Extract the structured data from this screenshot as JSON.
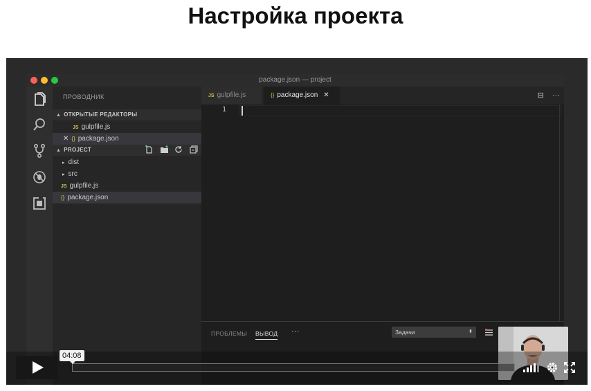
{
  "page": {
    "title": "Настройка проекта"
  },
  "window": {
    "title": "package.json — project"
  },
  "activity_bar": {
    "icons": [
      "files-icon",
      "search-icon",
      "source-control-icon",
      "debug-icon",
      "extensions-icon"
    ]
  },
  "sidebar": {
    "header": "ПРОВОДНИК",
    "open_editors": {
      "title": "ОТКРЫТЫЕ РЕДАКТОРЫ",
      "items": [
        {
          "badge": "JS",
          "label": "gulpfile.js"
        },
        {
          "close": "✕",
          "badge": "{}",
          "label": "package.json"
        }
      ]
    },
    "project": {
      "title": "PROJECT",
      "items": [
        {
          "badge": "▸",
          "label": "dist"
        },
        {
          "badge": "▸",
          "label": "src"
        },
        {
          "badge": "JS",
          "label": "gulpfile.js"
        },
        {
          "badge": "{}",
          "label": "package.json"
        }
      ]
    }
  },
  "tabs": [
    {
      "badge": "JS",
      "label": "gulpfile.js",
      "active": false
    },
    {
      "badge": "{}",
      "label": "package.json",
      "active": true,
      "close": "✕"
    }
  ],
  "editor": {
    "line_numbers": [
      "1"
    ],
    "actions": [
      "⊟",
      "···"
    ]
  },
  "panel": {
    "tabs": [
      "ПРОБЛЕМЫ",
      "ВЫВОД",
      "···"
    ],
    "task_select": {
      "value": "Задачи",
      "arrow": "⬍"
    }
  },
  "player": {
    "time": "04:08",
    "progress": 0.0
  },
  "colors": {
    "accent_yellow": "#d4c24a",
    "editor_bg": "#1e1e1e",
    "sidebar_bg": "#262626"
  }
}
